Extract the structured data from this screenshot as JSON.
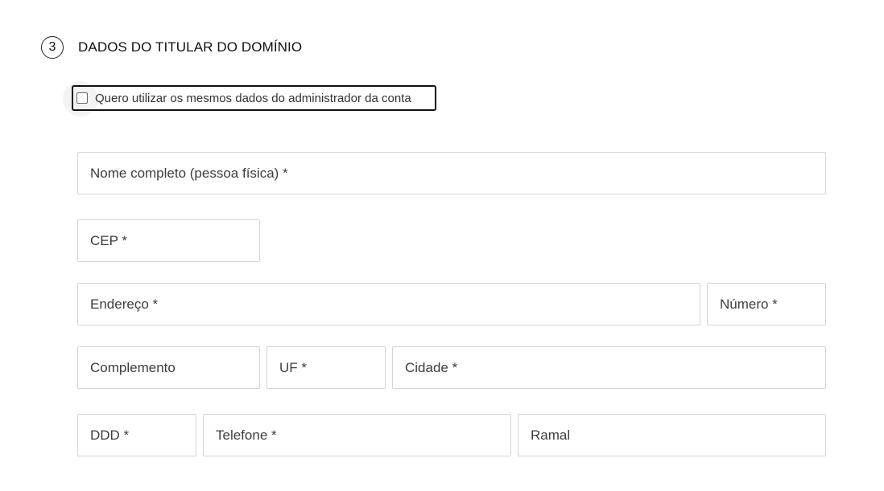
{
  "section": {
    "step_number": "3",
    "title": "DADOS DO TITULAR DO DOMÍNIO"
  },
  "same_data_checkbox": {
    "label": "Quero utilizar os mesmos dados do administrador da conta",
    "checked": false
  },
  "fields": {
    "full_name": {
      "placeholder": "Nome completo (pessoa física) *",
      "value": ""
    },
    "cep": {
      "placeholder": "CEP *",
      "value": ""
    },
    "address": {
      "placeholder": "Endereço *",
      "value": ""
    },
    "number": {
      "placeholder": "Número *",
      "value": ""
    },
    "complement": {
      "placeholder": "Complemento",
      "value": ""
    },
    "uf": {
      "placeholder": "UF *",
      "value": ""
    },
    "city": {
      "placeholder": "Cidade *",
      "value": ""
    },
    "ddd": {
      "placeholder": "DDD *",
      "value": ""
    },
    "phone": {
      "placeholder": "Telefone *",
      "value": ""
    },
    "extension": {
      "placeholder": "Ramal",
      "value": ""
    }
  },
  "colors": {
    "border": "#d4d4d4",
    "focus_outline": "#111111",
    "text": "#1f1f1f"
  }
}
